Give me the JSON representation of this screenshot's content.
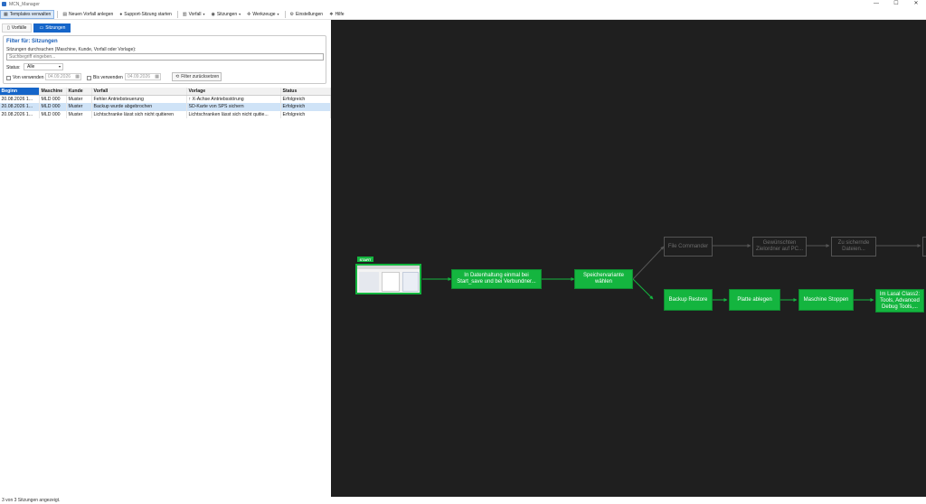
{
  "app": {
    "title": "MCN_Manager"
  },
  "window_controls": {
    "minimize": "—",
    "maximize": "☐",
    "close": "✕"
  },
  "toolbar": {
    "templates": "Templates verwalten",
    "new_case": "Neuen Vorfall anlegen",
    "support": "Support-Sitzung starten",
    "vorfall": "Vorfall",
    "sitzungen": "Sitzungen",
    "werkzeuge": "Werkzeuge",
    "einstellungen": "Einstellungen",
    "hilfe": "Hilfe"
  },
  "tabs": {
    "vorfaelle": "Vorfälle",
    "sitzungen": "Sitzungen"
  },
  "filter": {
    "title": "Filter für: Sitzungen",
    "description": "Sitzungen durchsuchen (Maschine, Kunde, Vorfall oder Vorlage):",
    "search_placeholder": "Suchbegriff eingeben...",
    "status_label": "Status:",
    "status_value": "Alle",
    "von_label": "Von verwenden",
    "von_date": "04.09.2026",
    "bis_label": "Bis verwenden",
    "bis_date": "04.09.2026",
    "reset_label": "Filter zurücksetzen"
  },
  "table": {
    "headers": [
      "Beginn",
      "Maschine",
      "Kunde",
      "Vorfall",
      "Vorlage",
      "Status"
    ],
    "rows": [
      [
        "20.08.2026 1...",
        "MLD 000",
        "Muster",
        "Fehler Antriebsteuerung",
        "↑ X-Achse Antriebsstörung",
        "Erfolgreich"
      ],
      [
        "20.08.2026 1...",
        "MLD 000",
        "Muster",
        "Backup wurde abgebrochen",
        "SD-Karte von SPS sichern",
        "Erfolgreich"
      ],
      [
        "20.08.2026 1...",
        "MLD 000",
        "Muster",
        "Lichtschranke lässt sich nicht quitieren",
        "Lichtschranken lässt sich nicht quitie...",
        "Erfolgreich"
      ]
    ]
  },
  "statusbar": {
    "text": "3 von 3 Sitzungen angezeigt."
  },
  "flow": {
    "start_badge": "START",
    "nodes": {
      "n1": "In      Datenhaltung einmal bei Start_save und bei Verbundner...",
      "n2": "Speichervariante wählen",
      "n3": "File Commander",
      "n4": "Gewünschten Zielordner auf PC...",
      "n5": "Zu sichernde Dateien...",
      "n6": "Backup Restore",
      "n7": "Platte ablegen",
      "n8": "Maschine Stoppen",
      "n9": "Im Lasal Class2: Tools, Advanced Debug Tools,..."
    }
  }
}
